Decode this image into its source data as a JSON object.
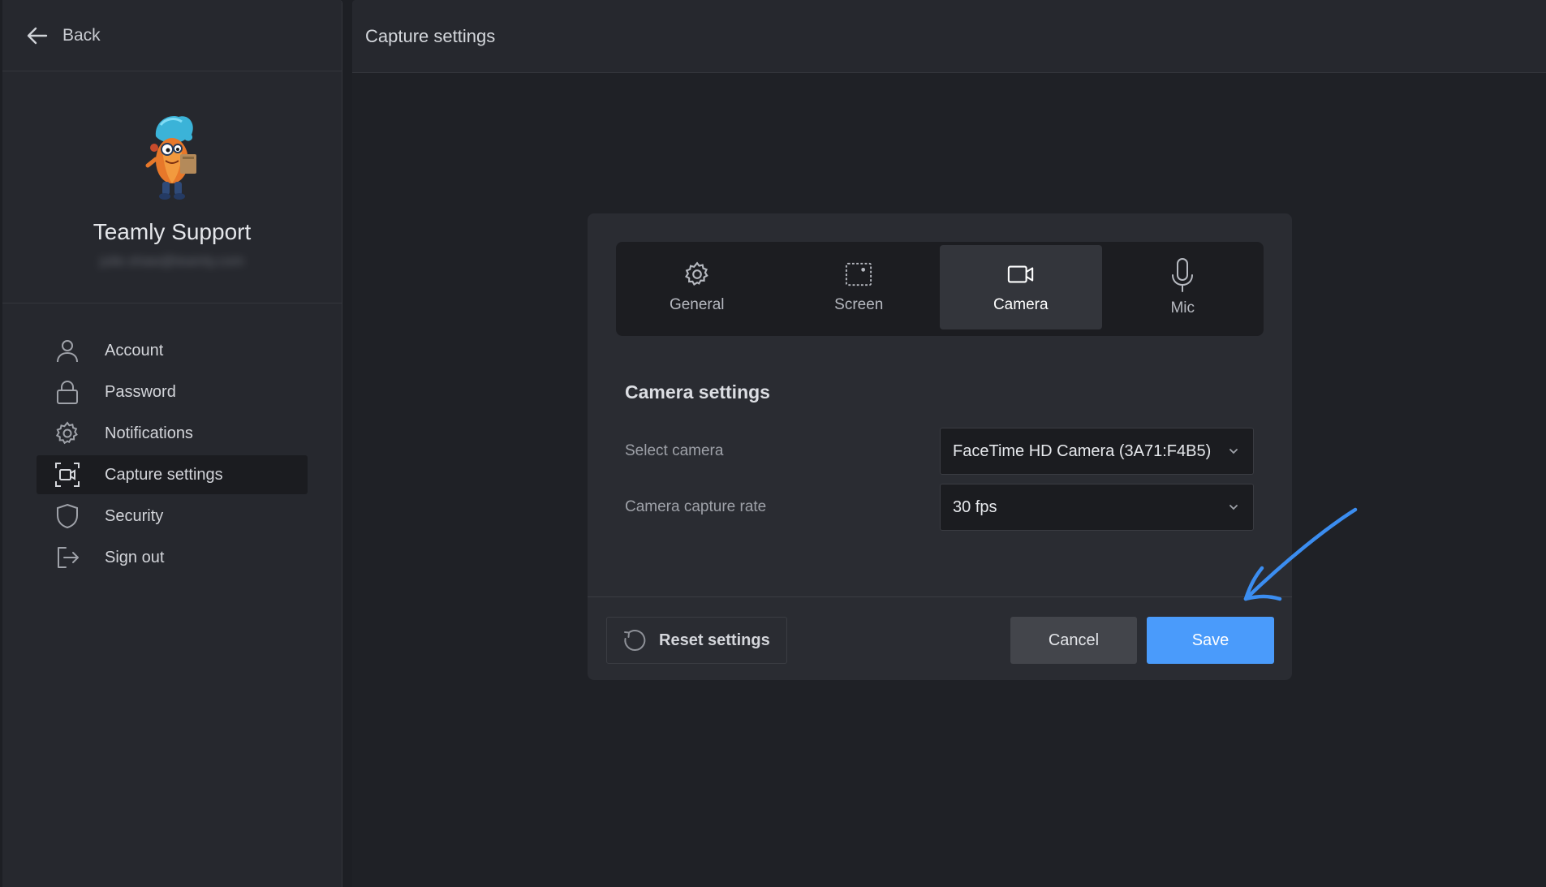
{
  "colors": {
    "accent": "#4a9bfb",
    "annotation_arrow": "#3b8df0",
    "background": "#1f2126",
    "sidebar": "#26282e"
  },
  "sidebar": {
    "back_label": "Back",
    "profile": {
      "name": "Teamly Support",
      "email_blurred": "julie.shaw@teamly.com"
    },
    "items": [
      {
        "label": "Account",
        "icon": "user-icon"
      },
      {
        "label": "Password",
        "icon": "lock-icon"
      },
      {
        "label": "Notifications",
        "icon": "gear-icon"
      },
      {
        "label": "Capture settings",
        "icon": "capture-icon",
        "active": true
      },
      {
        "label": "Security",
        "icon": "shield-icon"
      },
      {
        "label": "Sign out",
        "icon": "sign-out-icon"
      }
    ]
  },
  "header": {
    "title": "Capture settings"
  },
  "dialog": {
    "tabs": [
      {
        "label": "General",
        "icon": "gear-icon"
      },
      {
        "label": "Screen",
        "icon": "screen-capture-icon"
      },
      {
        "label": "Camera",
        "icon": "video-camera-icon",
        "active": true
      },
      {
        "label": "Mic",
        "icon": "microphone-icon"
      }
    ],
    "section_title": "Camera settings",
    "fields": {
      "camera": {
        "label": "Select camera",
        "value": "FaceTime HD Camera (3A71:F4B5)"
      },
      "rate": {
        "label": "Camera capture rate",
        "value": "30 fps"
      }
    },
    "buttons": {
      "reset": "Reset settings",
      "cancel": "Cancel",
      "save": "Save"
    }
  }
}
